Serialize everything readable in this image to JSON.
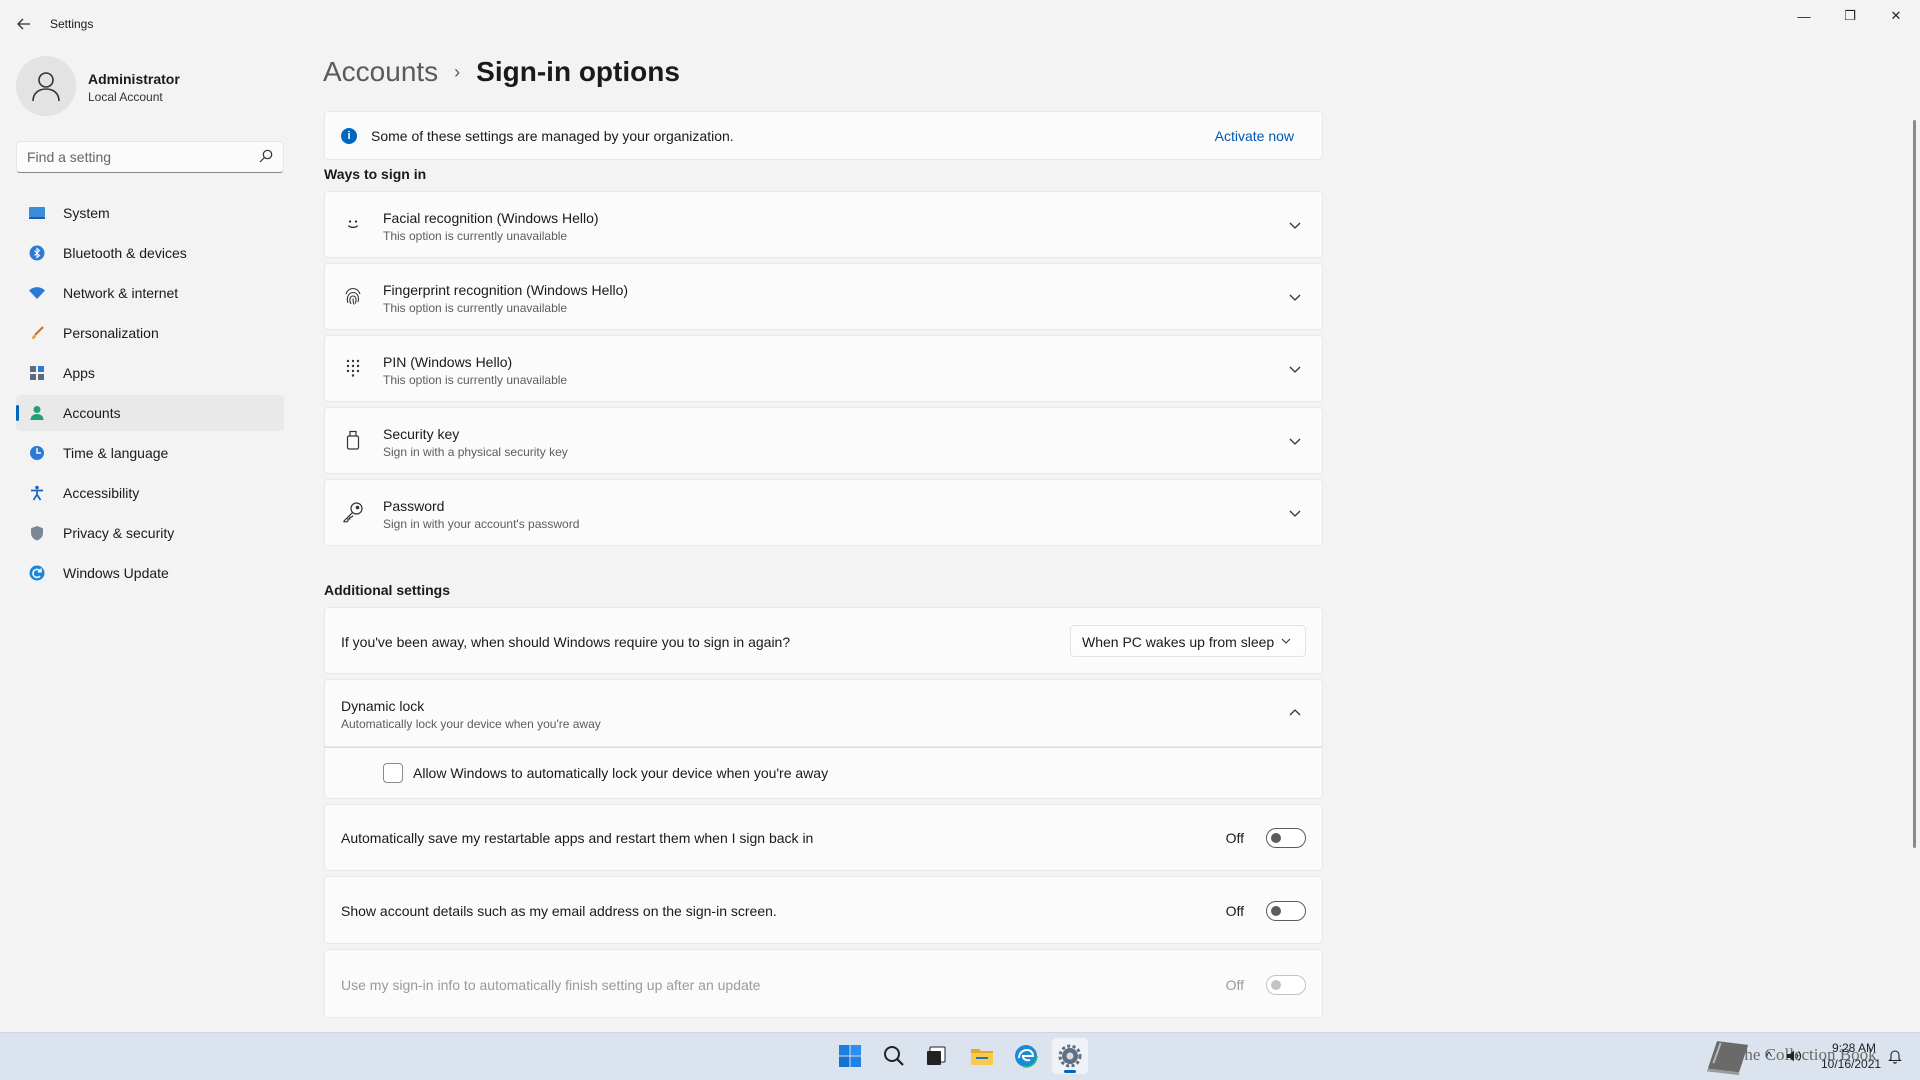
{
  "window": {
    "title": "Settings",
    "minimize_glyph": "—",
    "maximize_glyph": "❐",
    "close_glyph": "✕"
  },
  "profile": {
    "name": "Administrator",
    "account_type": "Local Account"
  },
  "search": {
    "placeholder": "Find a setting"
  },
  "nav": {
    "items": [
      {
        "label": "System",
        "icon": "system-icon"
      },
      {
        "label": "Bluetooth & devices",
        "icon": "bluetooth-icon"
      },
      {
        "label": "Network & internet",
        "icon": "network-icon"
      },
      {
        "label": "Personalization",
        "icon": "personalization-icon"
      },
      {
        "label": "Apps",
        "icon": "apps-icon"
      },
      {
        "label": "Accounts",
        "icon": "accounts-icon",
        "active": true
      },
      {
        "label": "Time & language",
        "icon": "time-language-icon"
      },
      {
        "label": "Accessibility",
        "icon": "accessibility-icon"
      },
      {
        "label": "Privacy & security",
        "icon": "shield-icon"
      },
      {
        "label": "Windows Update",
        "icon": "windows-update-icon"
      }
    ]
  },
  "breadcrumb": {
    "parent": "Accounts",
    "separator": "›",
    "current": "Sign-in options"
  },
  "banner": {
    "text": "Some of these settings are managed by your organization.",
    "icon_glyph": "i",
    "link": "Activate now"
  },
  "ways": {
    "heading": "Ways to sign in",
    "items": [
      {
        "title": "Facial recognition (Windows Hello)",
        "subtitle": "This option is currently unavailable",
        "icon": "face-icon"
      },
      {
        "title": "Fingerprint recognition (Windows Hello)",
        "subtitle": "This option is currently unavailable",
        "icon": "fingerprint-icon"
      },
      {
        "title": "PIN (Windows Hello)",
        "subtitle": "This option is currently unavailable",
        "icon": "pin-keypad-icon"
      },
      {
        "title": "Security key",
        "subtitle": "Sign in with a physical security key",
        "icon": "usb-key-icon"
      },
      {
        "title": "Password",
        "subtitle": "Sign in with your account's password",
        "icon": "key-icon"
      }
    ]
  },
  "additional": {
    "heading": "Additional settings",
    "require_signin": {
      "question": "If you've been away, when should Windows require you to sign in again?",
      "selected": "When PC wakes up from sleep"
    },
    "dynamic_lock": {
      "title": "Dynamic lock",
      "subtitle": "Automatically lock your device when you're away",
      "checkbox_label": "Allow Windows to automatically lock your device when you're away",
      "checked": false
    },
    "toggles": [
      {
        "label": "Automatically save my restartable apps and restart them when I sign back in",
        "state": "Off",
        "enabled": true
      },
      {
        "label": "Show account details such as my email address on the sign-in screen.",
        "state": "Off",
        "enabled": true
      },
      {
        "label": "Use my sign-in info to automatically finish setting up after an update",
        "state": "Off",
        "enabled": false
      }
    ]
  },
  "taskbar": {
    "apps": [
      "start-icon",
      "search-icon",
      "task-view-icon",
      "file-explorer-icon",
      "edge-icon",
      "settings-gear-icon"
    ],
    "watermark": "The Collection Book",
    "tray_chevron": "^",
    "clock_time": "9:28 AM",
    "clock_date": "10/16/2021"
  }
}
